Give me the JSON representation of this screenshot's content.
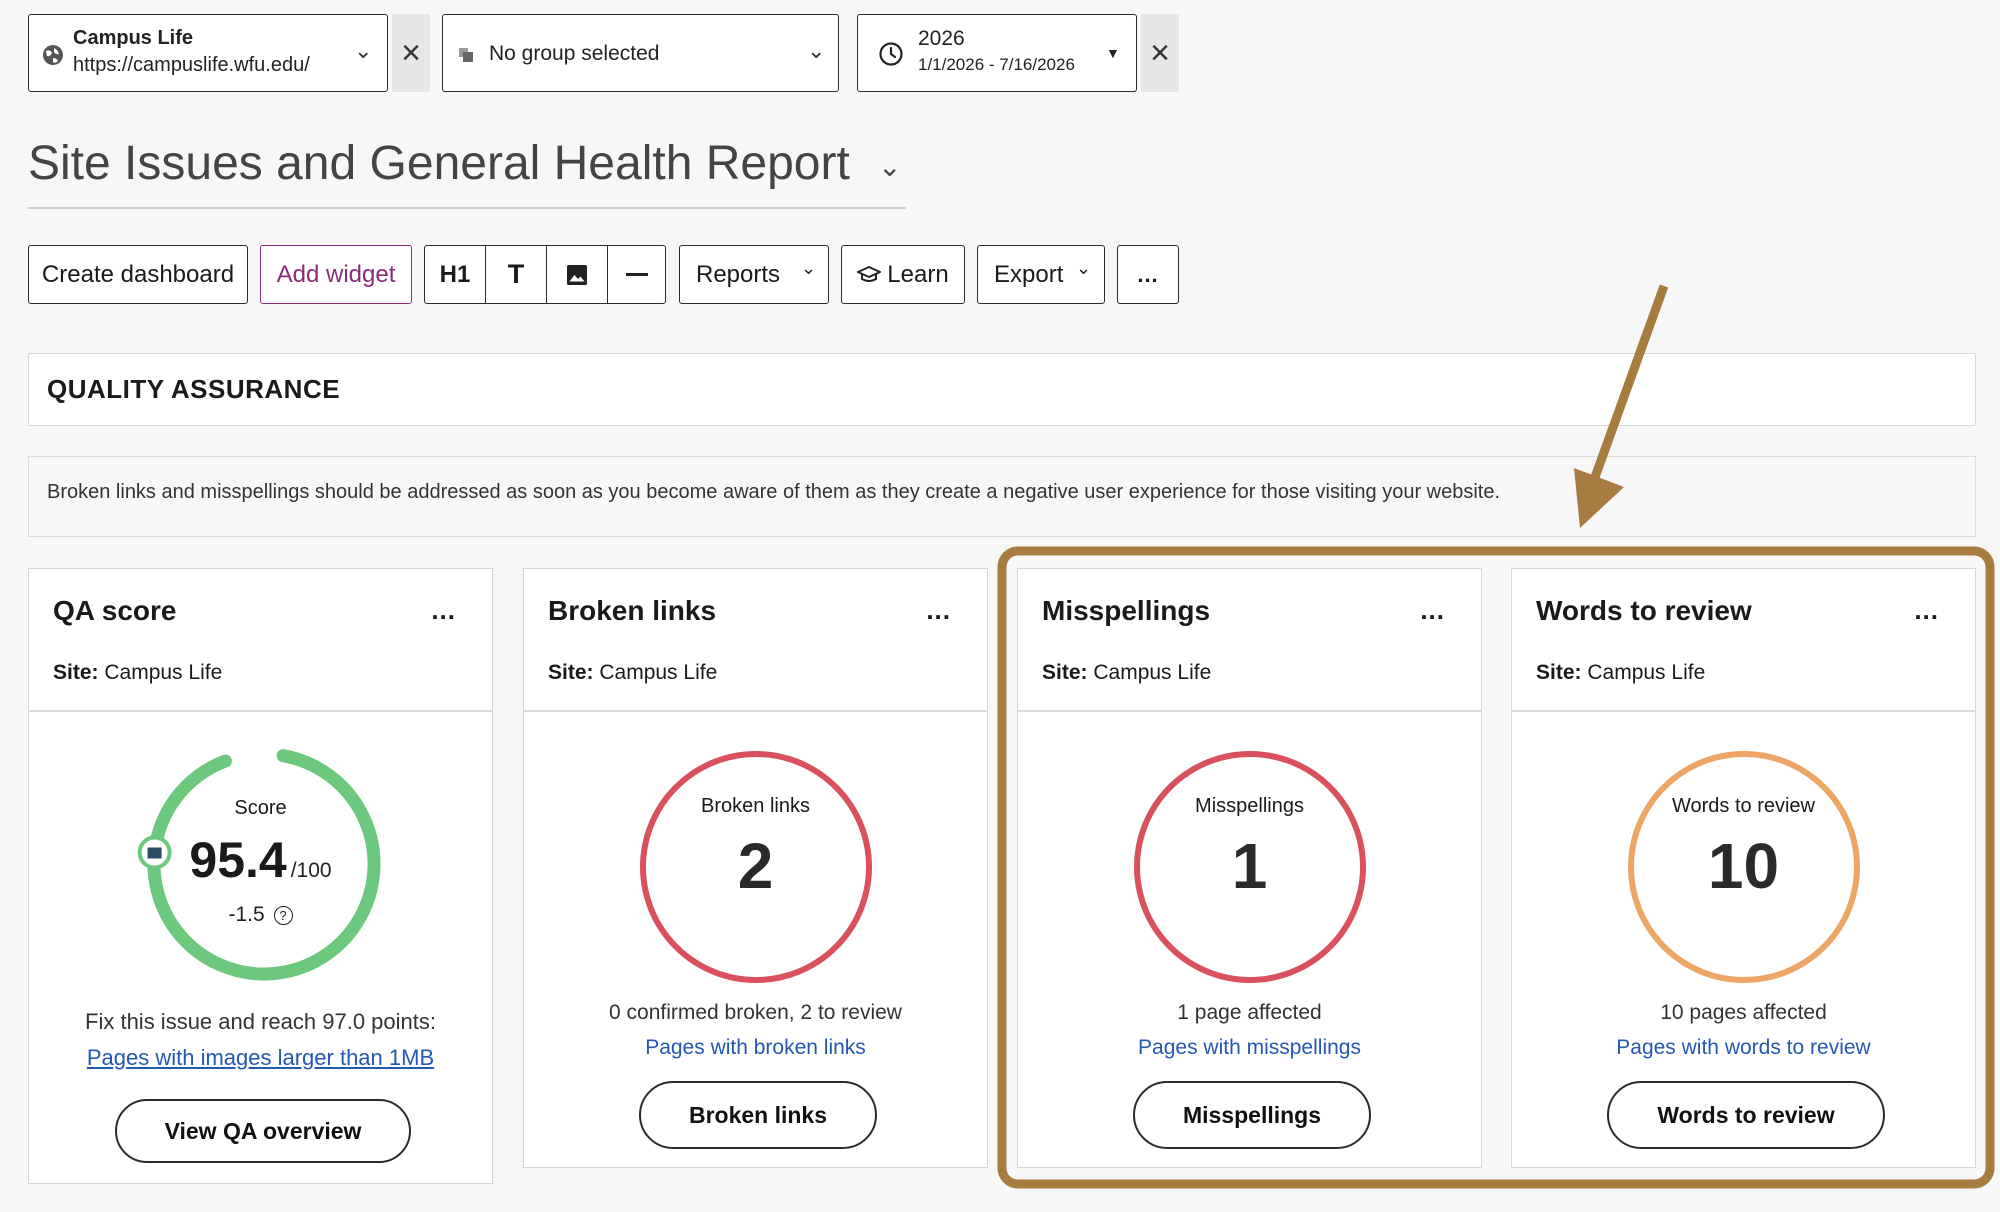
{
  "filters": {
    "site": {
      "name": "Campus Life",
      "url": "https://campuslife.wfu.edu/",
      "icon": "globe-icon"
    },
    "group": {
      "label": "No group selected",
      "icon": "group-icon"
    },
    "date": {
      "year": "2026",
      "range": "1/1/2026 - 7/16/2026",
      "icon": "clock-icon"
    }
  },
  "page": {
    "title": "Site Issues and General Health Report"
  },
  "toolbar": {
    "create_dashboard": "Create dashboard",
    "add_widget": "Add widget",
    "h1": "H1",
    "text": "T",
    "reports": "Reports",
    "learn": "Learn",
    "export": "Export",
    "more": "..."
  },
  "section": {
    "title": "QUALITY ASSURANCE",
    "description": "Broken links and misspellings should be addressed as soon as you become aware of them as they create a negative user experience for those visiting your website."
  },
  "widgets": [
    {
      "title": "QA score",
      "site_label": "Site:",
      "site": "Campus Life",
      "menu": "...",
      "ring_label": "Score",
      "score": "95.4",
      "score_max": "/100",
      "delta": "-1.5",
      "text": "Fix this issue and reach 97.0 points:",
      "link": "Pages with images larger than 1MB",
      "button": "View QA overview",
      "ring_color": "#6cc87c",
      "score_fraction": 0.954
    },
    {
      "title": "Broken links",
      "site_label": "Site:",
      "site": "Campus Life",
      "menu": "...",
      "ring_label": "Broken links",
      "value": "2",
      "text": "0 confirmed broken, 2 to review",
      "link": "Pages with broken links",
      "button": "Broken links",
      "ring_color": "#d9515d"
    },
    {
      "title": "Misspellings",
      "site_label": "Site:",
      "site": "Campus Life",
      "menu": "...",
      "ring_label": "Misspellings",
      "value": "1",
      "text": "1 page affected",
      "link": "Pages with misspellings",
      "button": "Misspellings",
      "ring_color": "#d9515d"
    },
    {
      "title": "Words to review",
      "site_label": "Site:",
      "site": "Campus Life",
      "menu": "...",
      "ring_label": "Words to review",
      "value": "10",
      "text": "10 pages affected",
      "link": "Pages with words to review",
      "button": "Words to review",
      "ring_color": "#eda665"
    }
  ],
  "annotation": {
    "color": "#a87b40"
  }
}
